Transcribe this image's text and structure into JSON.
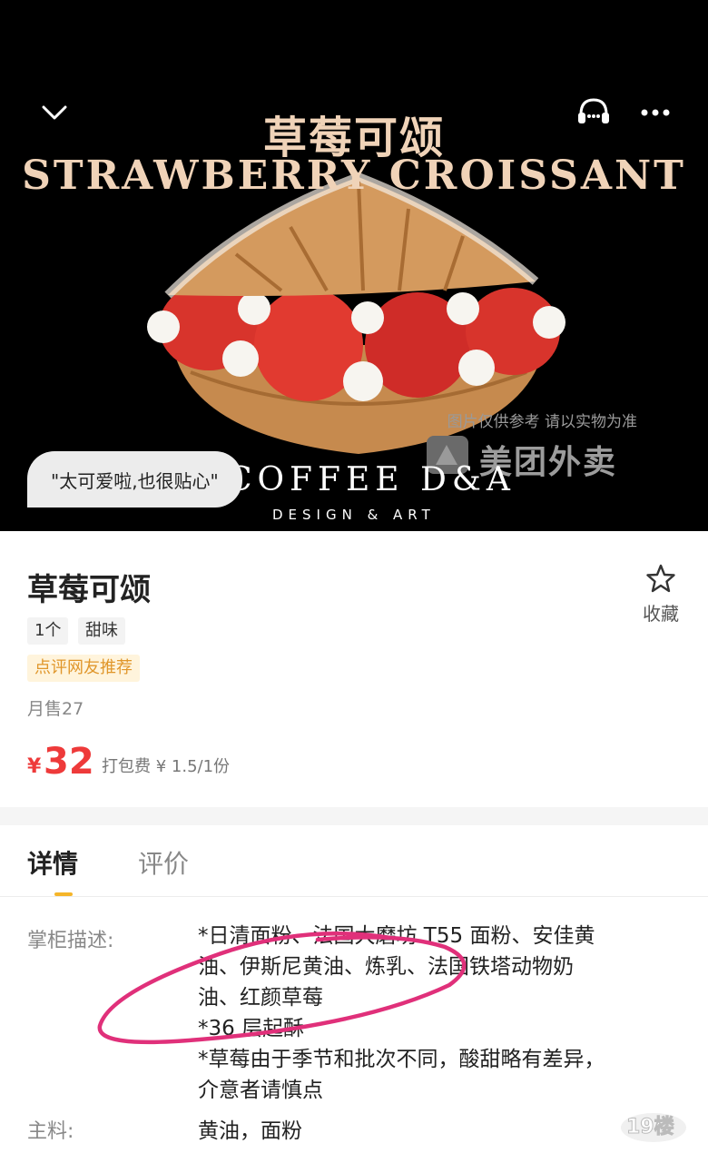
{
  "hero": {
    "title_cn": "草莓可颂",
    "title_en": "STRAWBERRY CROISSANT",
    "brand": "COFFEE D&A",
    "brand_sub": "DESIGN & ART",
    "watermark_note": "图片仅供参考 请以实物为准",
    "watermark_logo": "美团外卖",
    "review_bubble": "\"太可爱啦,也很贴心\"",
    "background_color": "#000000",
    "title_color": "#f0d3b8"
  },
  "nav": {
    "back_icon": "chevron-down-icon",
    "service_icon": "customer-service-icon",
    "more_icon": "more-dots-icon"
  },
  "product": {
    "name": "草莓可颂",
    "tags": [
      "1个",
      "甜味"
    ],
    "recommend": "点评网友推荐",
    "monthly_sales": "月售27",
    "price_symbol": "¥",
    "price": "32",
    "packing_fee": "打包费 ¥ 1.5/1份",
    "favorite_label": "收藏",
    "price_color": "#ee3a3a",
    "recommend_color": "#e0962a"
  },
  "tabs": {
    "detail": "详情",
    "review": "评价",
    "active": "详情",
    "indicator_color": "#f5b52a"
  },
  "details": {
    "desc_label": "掌柜描述:",
    "desc_lines": [
      "*日清面粉、法国大磨坊 T55 面粉、安佳黄",
      "油、伊斯尼黄油、炼乳、法国铁塔动物奶",
      "油、红颜草莓",
      "*36 层起酥",
      "*草莓由于季节和批次不同，酸甜略有差异，",
      "介意者请慎点"
    ],
    "main_label": "主料:",
    "main_value": "黄油，面粉",
    "annotation_color": "#e0307a"
  },
  "site_watermark": "19楼"
}
